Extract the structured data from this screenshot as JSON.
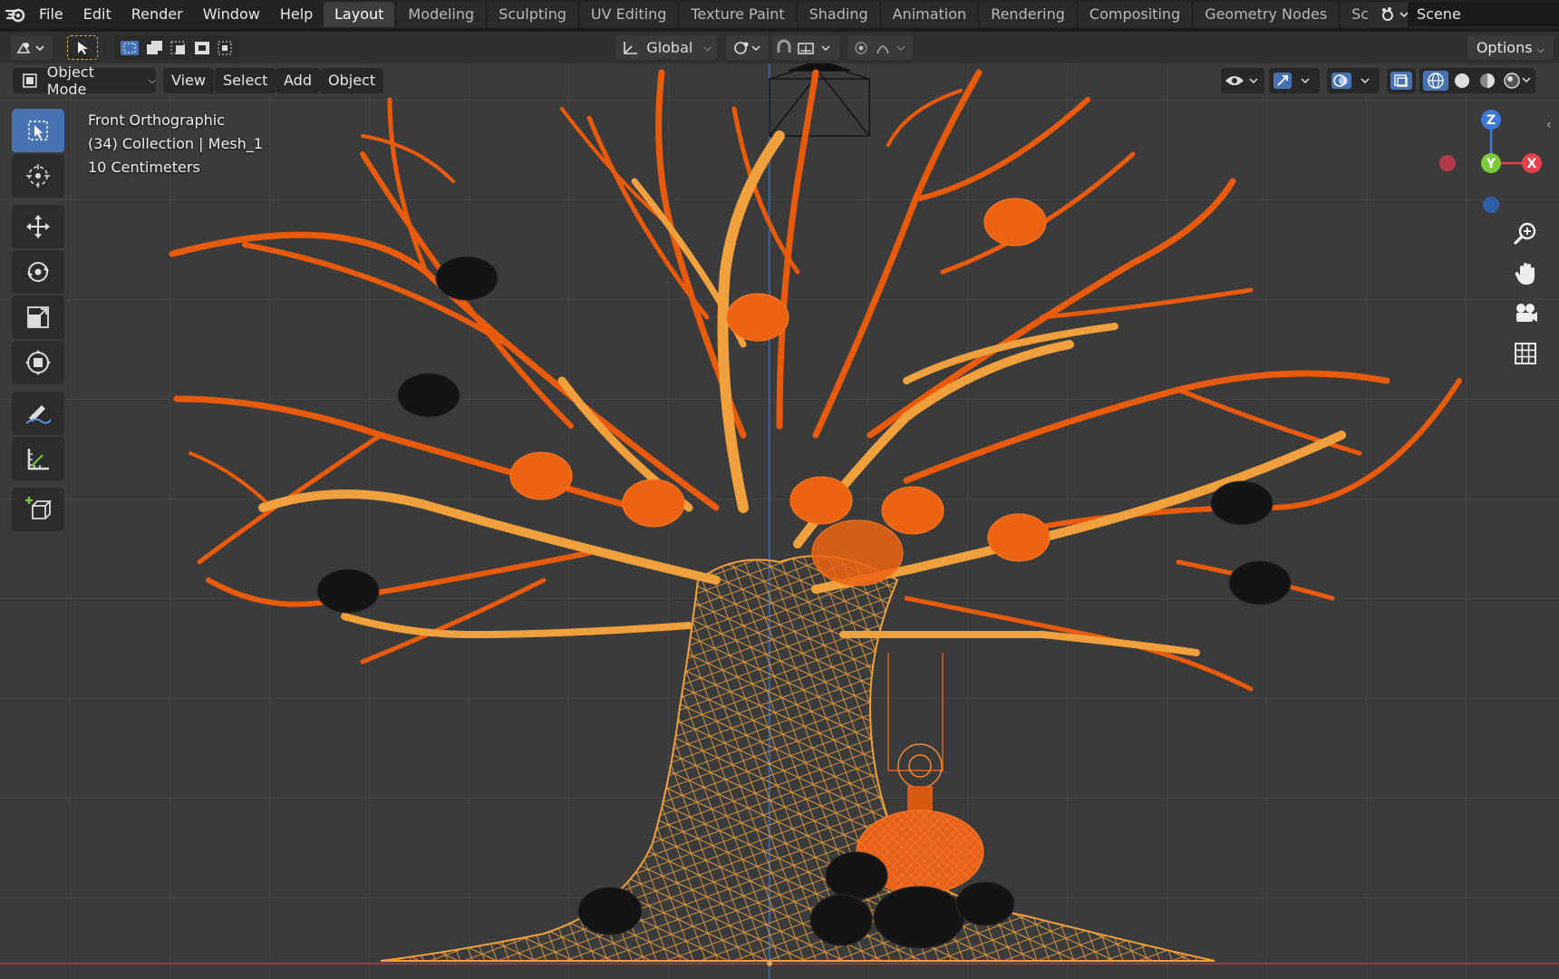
{
  "app": {
    "menu": [
      "File",
      "Edit",
      "Render",
      "Window",
      "Help"
    ],
    "tabs": [
      "Layout",
      "Modeling",
      "Sculpting",
      "UV Editing",
      "Texture Paint",
      "Shading",
      "Animation",
      "Rendering",
      "Compositing",
      "Geometry Nodes",
      "Scripting"
    ],
    "active_tab": "Layout",
    "scene": "Scene"
  },
  "tool_header": {
    "orientation": "Global",
    "options": "Options"
  },
  "viewport_header": {
    "mode": "Object Mode",
    "menus": [
      "View",
      "Select",
      "Add",
      "Object"
    ]
  },
  "viewport_info": {
    "view": "Front Orthographic",
    "collection": "(34) Collection | Mesh_1",
    "scale": "10 Centimeters"
  },
  "gizmo": {
    "axes": [
      "Z",
      "Y",
      "X"
    ]
  },
  "colors": {
    "accent": "#4772b3",
    "branch_dark": "#e85a0c",
    "branch_light": "#f0a03c",
    "x_axis": "#e8414e",
    "y_axis": "#7ac93a",
    "z_axis": "#3d7ad8"
  },
  "icons": {
    "toolbar": [
      "select-box-icon",
      "cursor-icon",
      "move-icon",
      "rotate-icon",
      "scale-icon",
      "transform-icon",
      "annotate-icon",
      "measure-icon",
      "add-cube-icon"
    ],
    "nav": [
      "zoom-icon",
      "hand-pan-icon",
      "camera-icon",
      "grid-icon"
    ]
  }
}
